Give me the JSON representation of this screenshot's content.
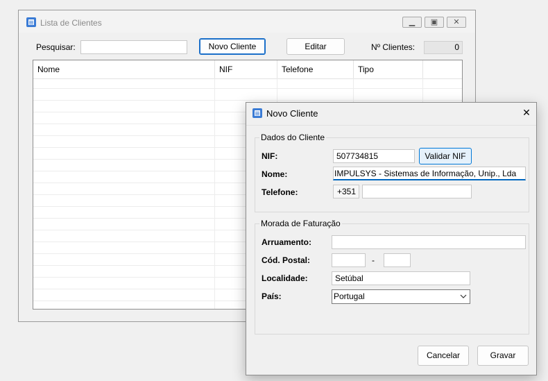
{
  "main": {
    "title": "Lista de Clientes",
    "search_label": "Pesquisar:",
    "search_value": "",
    "new_client_label": "Novo Cliente",
    "edit_label": "Editar",
    "count_label": "Nº Clientes:",
    "count_value": "0",
    "columns": [
      "Nome",
      "NIF",
      "Telefone",
      "Tipo"
    ]
  },
  "dialog": {
    "title": "Novo Cliente",
    "close_glyph": "✕",
    "client_group": {
      "title": "Dados do Cliente",
      "nif_label": "NIF:",
      "nif_value": "507734815",
      "validate_label": "Validar NIF",
      "name_label": "Nome:",
      "name_value": "IMPULSYS - Sistemas de Informação, Unip., Lda",
      "phone_label": "Telefone:",
      "phone_prefix": "+351",
      "phone_value": ""
    },
    "billing_group": {
      "title": "Morada de Faturação",
      "street_label": "Arruamento:",
      "street_value": "",
      "postal_label": "Cód. Postal:",
      "postal_part1": "",
      "postal_sep": "-",
      "postal_part2": "",
      "city_label": "Localidade:",
      "city_value": "Setúbal",
      "country_label": "País:",
      "country_value": "Portugal"
    },
    "cancel_label": "Cancelar",
    "save_label": "Gravar"
  }
}
